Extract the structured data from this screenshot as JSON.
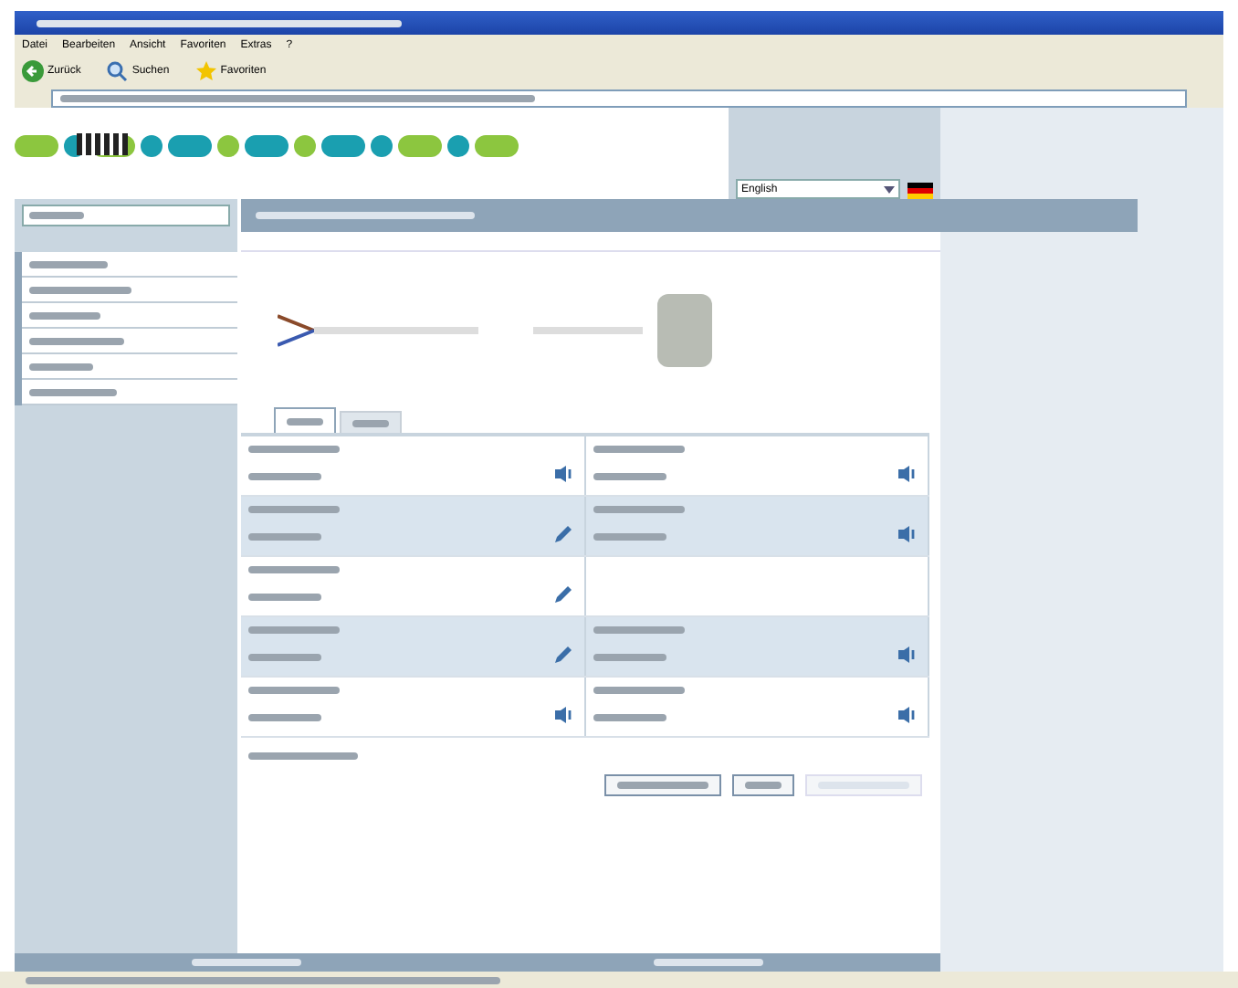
{
  "browser": {
    "menu": [
      "Datei",
      "Bearbeiten",
      "Ansicht",
      "Favoriten",
      "Extras",
      "?"
    ],
    "toolbar": [
      "Zurück",
      "Suchen",
      "Favoriten"
    ]
  },
  "page": {
    "language": "English",
    "tabs": [
      {
        "selected": true
      },
      {
        "selected": false
      }
    ],
    "rows": [
      {
        "shaded": false,
        "cells": [
          {
            "kind": "info"
          },
          {
            "kind": "info"
          }
        ]
      },
      {
        "shaded": true,
        "cells": [
          {
            "kind": "edit"
          },
          {
            "kind": "info"
          }
        ]
      },
      {
        "shaded": false,
        "cells": [
          {
            "kind": "edit"
          },
          {
            "kind": "empty"
          }
        ]
      },
      {
        "shaded": true,
        "cells": [
          {
            "kind": "edit"
          },
          {
            "kind": "info"
          }
        ]
      },
      {
        "shaded": false,
        "cells": [
          {
            "kind": "info"
          },
          {
            "kind": "info"
          }
        ]
      }
    ]
  }
}
